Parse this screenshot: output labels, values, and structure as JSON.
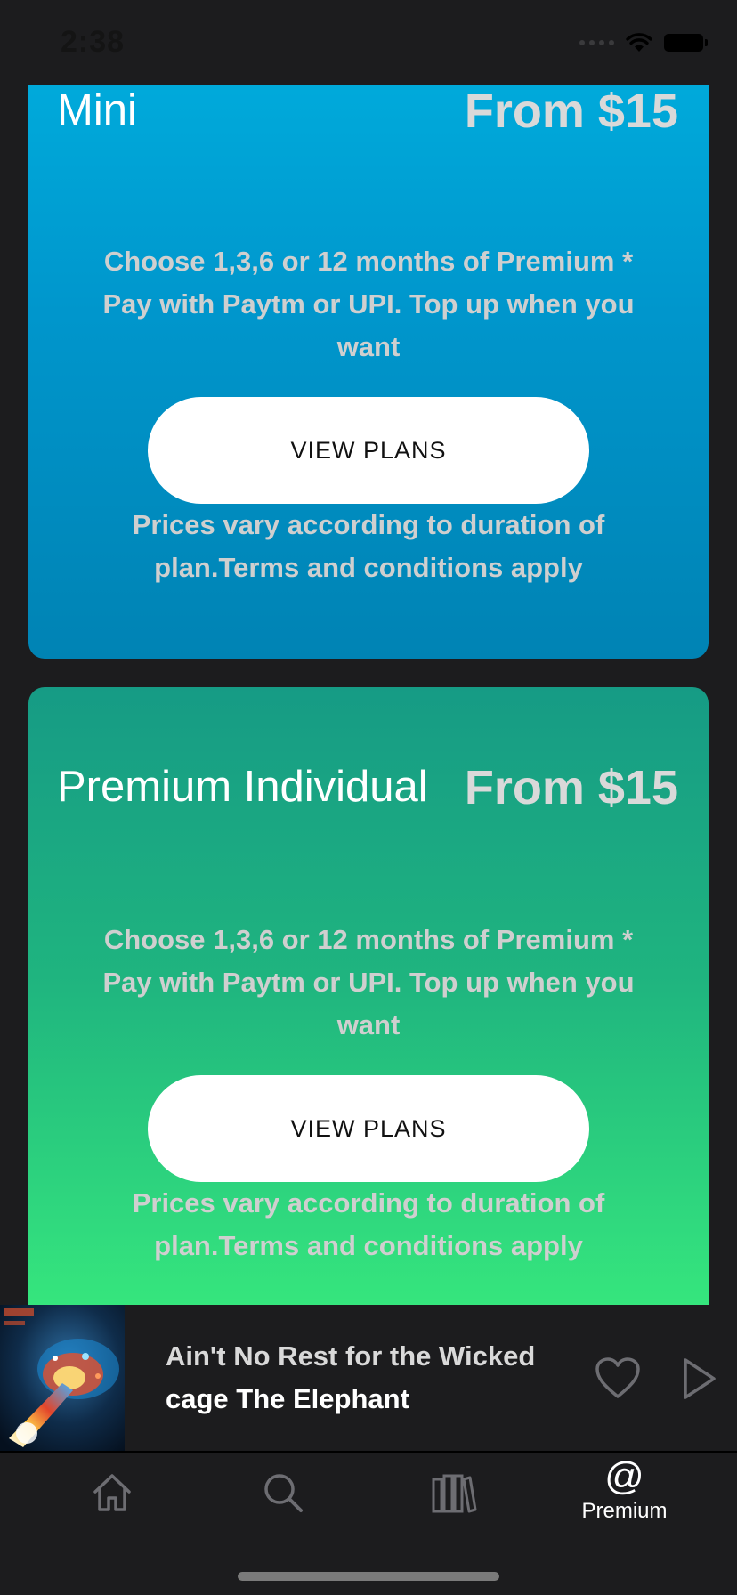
{
  "status_bar": {
    "time": "2:38"
  },
  "plans": [
    {
      "name": "Mini",
      "price": "From $15",
      "description": "Choose 1,3,6 or 12 months of Premium * Pay with Paytm or UPI. Top up when you want",
      "button_label": "VIEW PLANS",
      "terms": "Prices vary according to duration of plan.Terms and conditions apply",
      "gradient_colors": [
        "#00aede",
        "#0083b4"
      ]
    },
    {
      "name": "Premium Individual",
      "price": "From $15",
      "description": "Choose 1,3,6 or 12 months of Premium * Pay with Paytm or UPI. Top up when you want",
      "button_label": "VIEW PLANS",
      "terms": "Prices vary according to duration of plan.Terms and conditions apply",
      "gradient_colors": [
        "#169b85",
        "#37e97d"
      ]
    }
  ],
  "now_playing": {
    "title": "Ain't No Rest for the Wicked",
    "artist": "cage The Elephant",
    "art_icon": "album-art",
    "like_icon": "heart-icon",
    "play_icon": "play-icon"
  },
  "tab_bar": {
    "tabs": [
      {
        "label": "",
        "icon": "home-icon",
        "active": false
      },
      {
        "label": "",
        "icon": "search-icon",
        "active": false
      },
      {
        "label": "",
        "icon": "library-icon",
        "active": false
      },
      {
        "label": "Premium",
        "icon": "premium-at-icon",
        "active": true
      }
    ]
  },
  "colors": {
    "background": "#1c1c1e",
    "muted_text": "#cfcfcf",
    "icon_gray": "#6d6d72"
  }
}
